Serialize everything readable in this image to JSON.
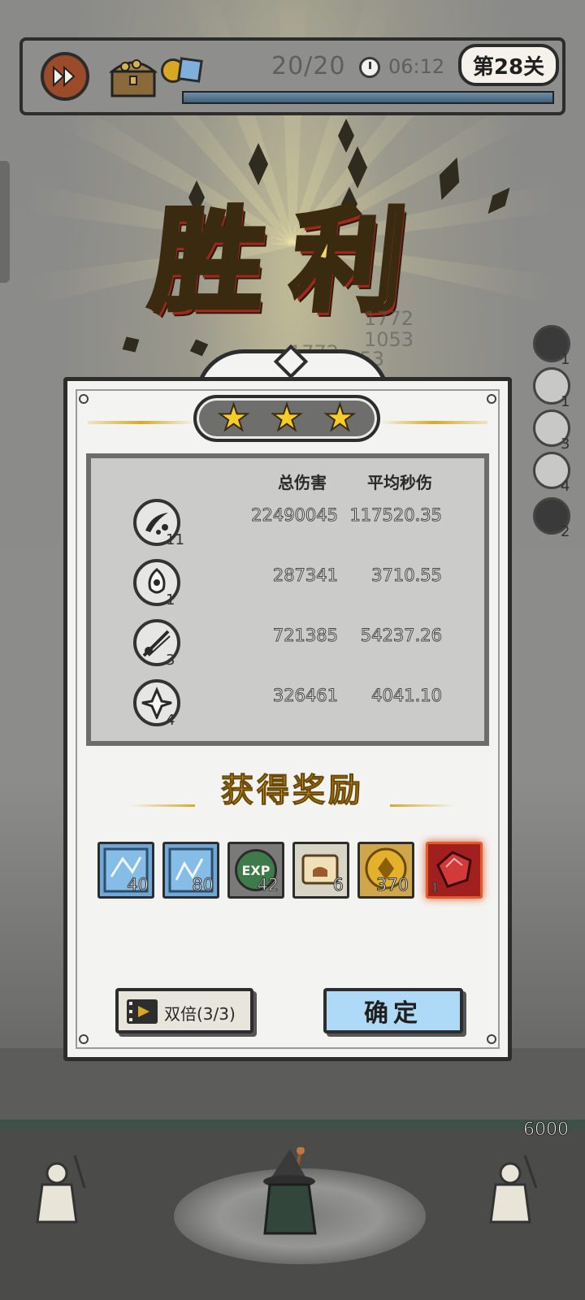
{
  "header": {
    "wave_progress": "20/20",
    "timer": "06:12",
    "level_label": "第28关",
    "progress_fraction": 1.0
  },
  "title": {
    "victory": "胜利"
  },
  "floating_numbers": [
    "1772",
    "1053",
    "1772",
    "1053"
  ],
  "side_skills": [
    {
      "icon": "slash-skill-icon",
      "count": "1"
    },
    {
      "icon": "spirit-skill-icon",
      "count": "1"
    },
    {
      "icon": "comet-skill-icon",
      "count": "3"
    },
    {
      "icon": "crystal-skill-icon",
      "count": "4"
    },
    {
      "icon": "blade-skill-icon",
      "count": "2"
    }
  ],
  "result": {
    "stars": 3,
    "columns": {
      "total_damage": "总伤害",
      "avg_dps": "平均秒伤"
    },
    "skills": [
      {
        "icon": "ink-splash-icon",
        "level": "11",
        "total": "22490045",
        "dps": "117520.35"
      },
      {
        "icon": "ghost-flame-icon",
        "level": "1",
        "total": "287341",
        "dps": "3710.55"
      },
      {
        "icon": "comet-streak-icon",
        "level": "3",
        "total": "721385",
        "dps": "54237.26"
      },
      {
        "icon": "crystal-burst-icon",
        "level": "4",
        "total": "326461",
        "dps": "4041.10"
      }
    ],
    "rewards_title": "获得奖励",
    "rewards": [
      {
        "icon": "blue-rune-stone-icon",
        "count": "40"
      },
      {
        "icon": "blue-rune-stone-icon",
        "count": "80"
      },
      {
        "icon": "exp-orb-icon",
        "label": "EXP",
        "count": "42"
      },
      {
        "icon": "scroll-icon",
        "count": "6"
      },
      {
        "icon": "gold-coin-icon",
        "count": "370"
      },
      {
        "icon": "red-gem-icon",
        "count": "1"
      }
    ],
    "double_button": "双倍(3/3)",
    "confirm_button": "确定"
  },
  "base": {
    "hp": "6000"
  },
  "colors": {
    "star": "#f6cd27",
    "victory_text": "#f4d46a",
    "reward_title": "#e2a51b",
    "confirm_button": "#aedaf7",
    "rare_item_border": "#e05a2a"
  }
}
